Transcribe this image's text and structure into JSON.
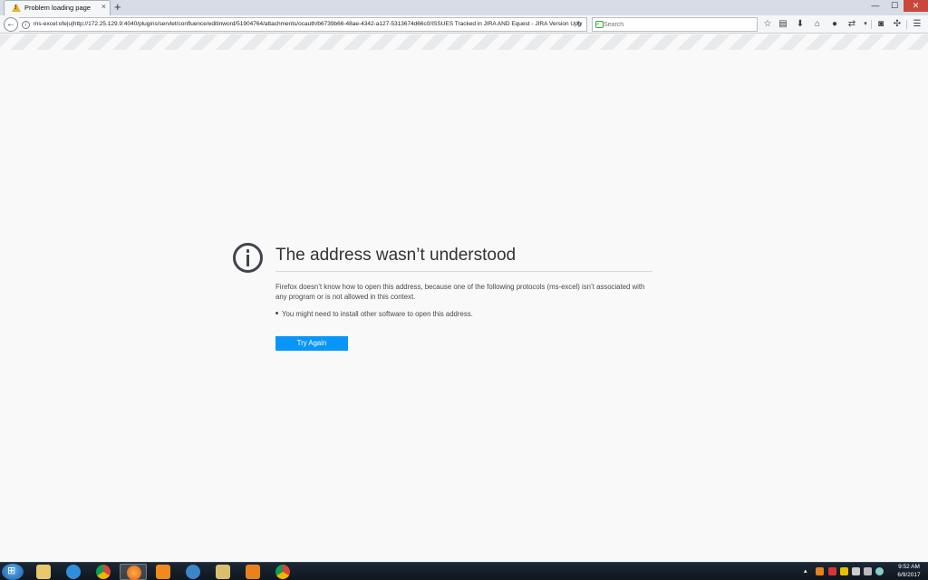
{
  "browser": {
    "tab": {
      "title": "Problem loading page",
      "close": "×"
    },
    "new_tab": "+",
    "window_controls": {
      "minimize": "—",
      "maximize": "☐",
      "close": "✕"
    },
    "back": "←",
    "url": "ms-excel:ofe|u|http://172.25.129.9:4040/plugins/servlet/confluence/editinword/51904764/attachments/ocauth/b6739b66-48ae-4342-a127-5313674d66c0/ISSUES Tracked in JIRA AND Equest - JIRA Version Upg",
    "reload": "↻",
    "search_placeholder": "Search",
    "toolbar_icons": [
      "star-icon",
      "reading-list-icon",
      "download-icon",
      "home-icon",
      "account-icon",
      "send-icon",
      "dropdown-icon",
      "pocket-icon",
      "extension-icon",
      "menu-icon"
    ]
  },
  "error": {
    "title": "The address wasn’t understood",
    "description": "Firefox doesn’t know how to open this address, because one of the following protocols (ms-excel) isn’t associated with any program or is not allowed in this context.",
    "bullet": "You might need to install other software to open this address.",
    "button": "Try Again"
  },
  "taskbar": {
    "apps": [
      "file-explorer",
      "internet-explorer",
      "chrome",
      "firefox",
      "media-player",
      "communicator",
      "folder",
      "outlook",
      "chrome"
    ],
    "active_app": "firefox",
    "clock": {
      "time": "9:52 AM",
      "date": "6/9/2017"
    }
  },
  "colors": {
    "accent": "#0996f8",
    "close": "#c9483b",
    "warning": "#e8b22b"
  }
}
